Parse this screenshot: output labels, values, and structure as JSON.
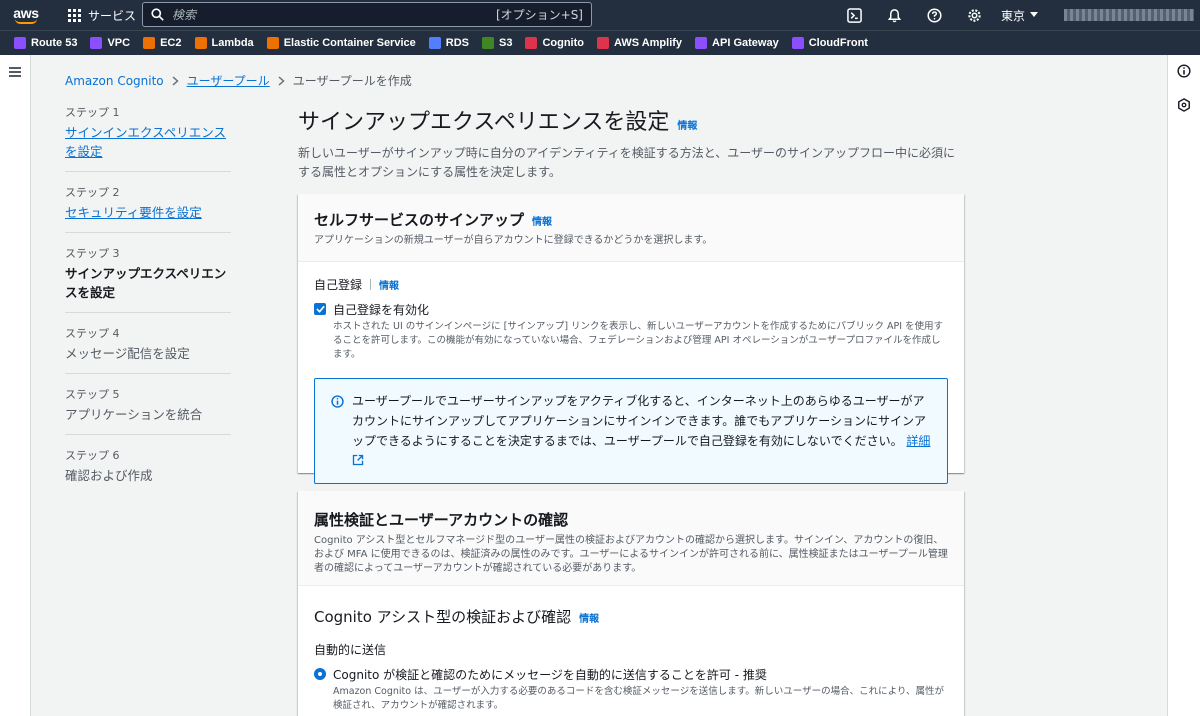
{
  "topnav": {
    "logo_text": "aws",
    "services_label": "サービス",
    "search_placeholder": "検索",
    "search_shortcut": "[オプション+S]",
    "region": "東京"
  },
  "favorites": [
    {
      "label": "Route 53",
      "color": "#8c4fff"
    },
    {
      "label": "VPC",
      "color": "#8c4fff"
    },
    {
      "label": "EC2",
      "color": "#ed7100"
    },
    {
      "label": "Lambda",
      "color": "#ed7100"
    },
    {
      "label": "Elastic Container Service",
      "color": "#ed7100"
    },
    {
      "label": "RDS",
      "color": "#527fff"
    },
    {
      "label": "S3",
      "color": "#3f8624"
    },
    {
      "label": "Cognito",
      "color": "#dd344c"
    },
    {
      "label": "AWS Amplify",
      "color": "#dd344c"
    },
    {
      "label": "API Gateway",
      "color": "#8c4fff"
    },
    {
      "label": "CloudFront",
      "color": "#8c4fff"
    }
  ],
  "breadcrumb": {
    "item1": "Amazon Cognito",
    "item2": "ユーザープール",
    "current": "ユーザープールを作成"
  },
  "steps": [
    {
      "label": "ステップ 1",
      "title": "サインインエクスペリエンスを設定",
      "state": "link"
    },
    {
      "label": "ステップ 2",
      "title": "セキュリティ要件を設定",
      "state": "link"
    },
    {
      "label": "ステップ 3",
      "title": "サインアップエクスペリエンスを設定",
      "state": "active"
    },
    {
      "label": "ステップ 4",
      "title": "メッセージ配信を設定",
      "state": "disabled"
    },
    {
      "label": "ステップ 5",
      "title": "アプリケーションを統合",
      "state": "disabled"
    },
    {
      "label": "ステップ 6",
      "title": "確認および作成",
      "state": "disabled"
    }
  ],
  "page": {
    "title": "サインアップエクスペリエンスを設定",
    "info": "情報",
    "description": "新しいユーザーがサインアップ時に自分のアイデンティティを検証する方法と、ユーザーのサインアップフロー中に必須にする属性とオプションにする属性を決定します。"
  },
  "self_service": {
    "title": "セルフサービスのサインアップ",
    "info": "情報",
    "subtitle": "アプリケーションの新規ユーザーが自らアカウントに登録できるかどうかを選択します。",
    "field_label": "自己登録",
    "field_info": "情報",
    "checkbox_label": "自己登録を有効化",
    "checkbox_checked": true,
    "checkbox_desc": "ホストされた UI のサインインページに [サインアップ] リンクを表示し、新しいユーザーアカウントを作成するためにパブリック API を使用することを許可します。この機能が有効になっていない場合、フェデレーションおよび管理 API オペレーションがユーザープロファイルを作成します。",
    "alert_text": "ユーザープールでユーザーサインアップをアクティブ化すると、インターネット上のあらゆるユーザーがアカウントにサインアップしてアプリケーションにサインインできます。誰でもアプリケーションにサインアップできるようにすることを決定するまでは、ユーザープールで自己登録を有効にしないでください。",
    "alert_link": "詳細"
  },
  "attr_verify": {
    "title": "属性検証とユーザーアカウントの確認",
    "subtitle": "Cognito アシスト型とセルフマネージド型のユーザー属性の検証およびアカウントの確認から選択します。サインイン、アカウントの復旧、および MFA に使用できるのは、検証済みの属性のみです。ユーザーによるサインインが許可される前に、属性検証またはユーザープール管理者の確認によってユーザーアカウントが確認されている必要があります。",
    "section_title": "Cognito アシスト型の検証および確認",
    "section_info": "情報",
    "field_label": "自動的に送信",
    "radio_label": "Cognito が検証と確認のためにメッセージを自動的に送信することを許可 - 推奨",
    "radio_desc": "Amazon Cognito は、ユーザーが入力する必要のあるコードを含む検証メッセージを送信します。新しいユーザーの場合、これにより、属性が検証され、アカウントが確認されます。"
  }
}
